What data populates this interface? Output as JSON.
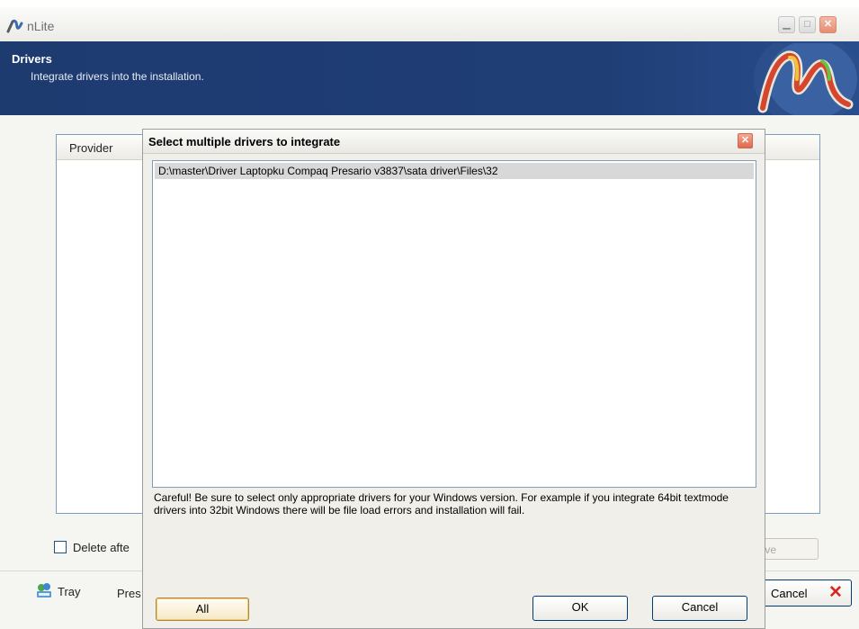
{
  "window": {
    "title": "nLite",
    "logo_icon": "nlite-logo-icon",
    "minimize_icon": "minimize-icon",
    "maximize_icon": "maximize-icon",
    "close_icon": "close-icon"
  },
  "banner": {
    "title": "Drivers",
    "subtitle": "Integrate drivers into the installation.",
    "accent_color": "#1e3b70"
  },
  "driver_list": {
    "columns": [
      "Provider"
    ]
  },
  "options": {
    "delete_label": "Delete afte"
  },
  "buttons": {
    "remove_label": "nove",
    "tray_label": "Tray",
    "press_label": "Pres",
    "cancel_label": "Cancel"
  },
  "dialog": {
    "title": "Select multiple drivers to integrate",
    "paths": [
      "D:\\master\\Driver Laptopku Compaq Presario v3837\\sata driver\\Files\\32"
    ],
    "warning": "Careful! Be sure to select only appropriate drivers for your Windows version. For example if you integrate 64bit textmode drivers into 32bit Windows there will be file load errors and installation will fail.",
    "all_label": "All",
    "ok_label": "OK",
    "cancel_label": "Cancel"
  }
}
